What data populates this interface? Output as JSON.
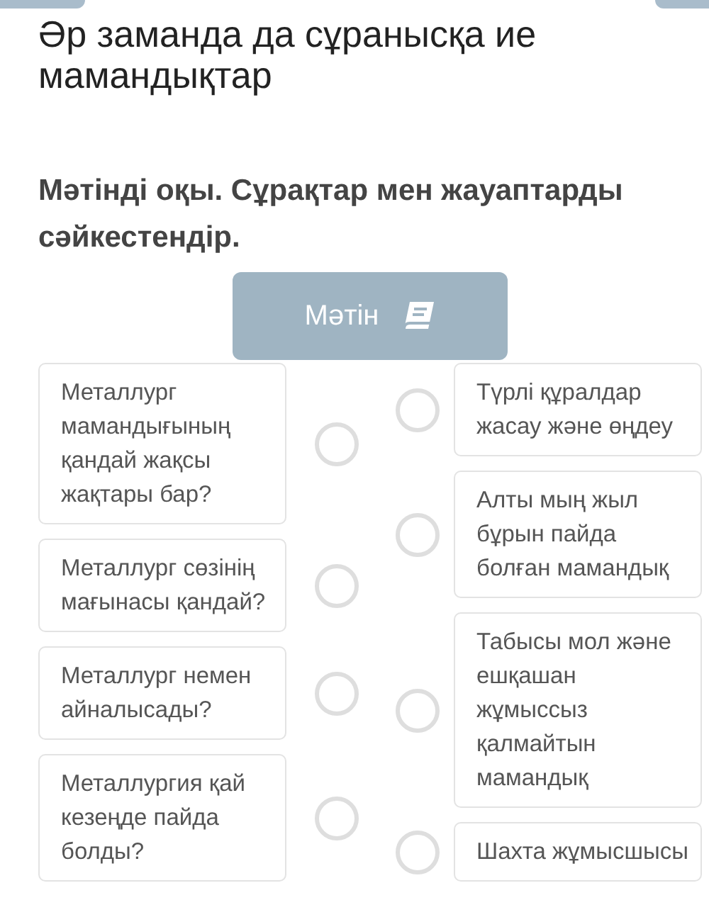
{
  "title": "Әр заманда да сұранысқа ие мамандықтар",
  "instruction": "Мәтінді оқы. Сұрақтар мен жауаптарды сәйкестендір.",
  "text_button": {
    "label": "Мәтін"
  },
  "questions": [
    {
      "text": "Металлург мамандығының қандай жақсы жақтары бар?"
    },
    {
      "text": "Металлург сөзінің мағынасы қандай?"
    },
    {
      "text": "Металлург немен айналысады?"
    },
    {
      "text": "Металлургия қай кезеңде пайда болды?"
    }
  ],
  "answers": [
    {
      "text": "Түрлі құралдар жасау және өңдеу"
    },
    {
      "text": "Алты мың жыл бұрын пайда болған мамандық"
    },
    {
      "text": "Табысы мол және ешқашан жұмыссыз қалмайтын мамандық"
    },
    {
      "text": "Шахта жұмысшысы"
    }
  ]
}
